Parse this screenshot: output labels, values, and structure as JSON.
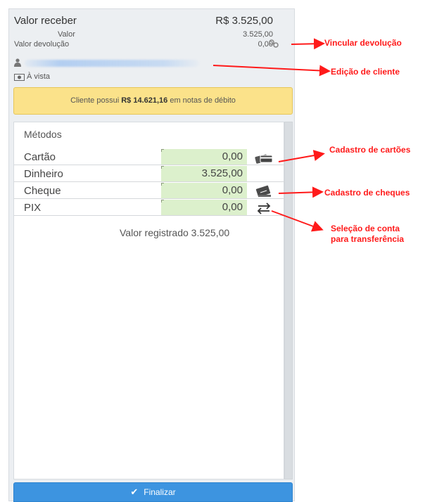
{
  "header": {
    "title": "Valor receber",
    "total": "R$ 3.525,00",
    "value_label": "Valor",
    "value": "3.525,00",
    "return_label": "Valor devolução",
    "return_value": "0,00"
  },
  "client": {
    "payment_term": "À vista"
  },
  "alert": {
    "prefix": "Cliente possui",
    "amount": "R$ 14.621,16",
    "suffix": "em notas de débito"
  },
  "methods": {
    "title": "Métodos",
    "rows": [
      {
        "name": "Cartão",
        "value": "0,00",
        "icon": "credit-card-icon"
      },
      {
        "name": "Dinheiro",
        "value": "3.525,00",
        "icon": ""
      },
      {
        "name": "Cheque",
        "value": "0,00",
        "icon": "check-icon"
      },
      {
        "name": "PIX",
        "value": "0,00",
        "icon": "transfer-icon"
      }
    ],
    "registered": "Valor registrado 3.525,00"
  },
  "finish_label": "Finalizar",
  "annotations": {
    "link_return": "Vincular devolução",
    "edit_client": "Edição de cliente",
    "cards": "Cadastro de cartões",
    "checks": "Cadastro de cheques",
    "account_select_1": "Seleção de conta",
    "account_select_2": "para transferência"
  },
  "colors": {
    "alert_bg": "#fbe28a",
    "input_bg": "#dcf0cc",
    "button_bg": "#3d94e0",
    "annotation": "#ff1a1a"
  }
}
